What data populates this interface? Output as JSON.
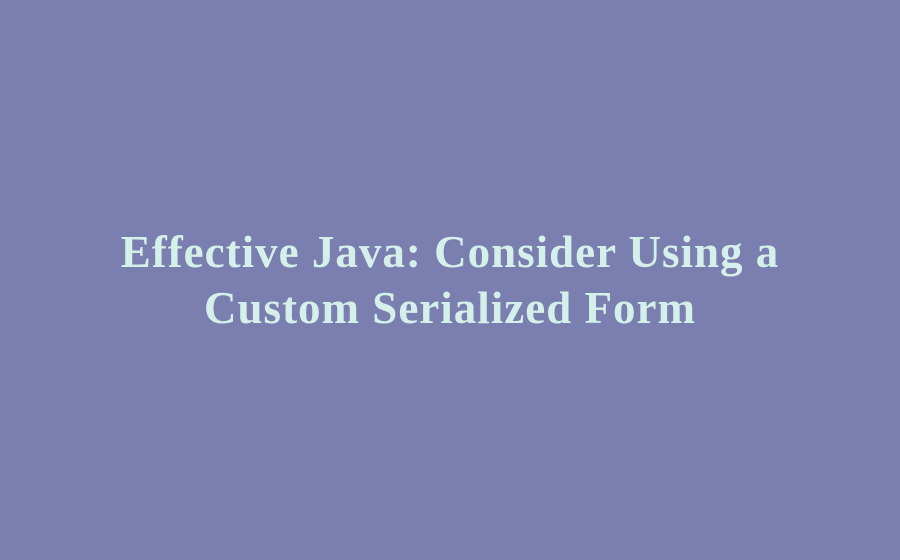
{
  "title": "Effective Java: Consider Using a Custom Serialized Form"
}
